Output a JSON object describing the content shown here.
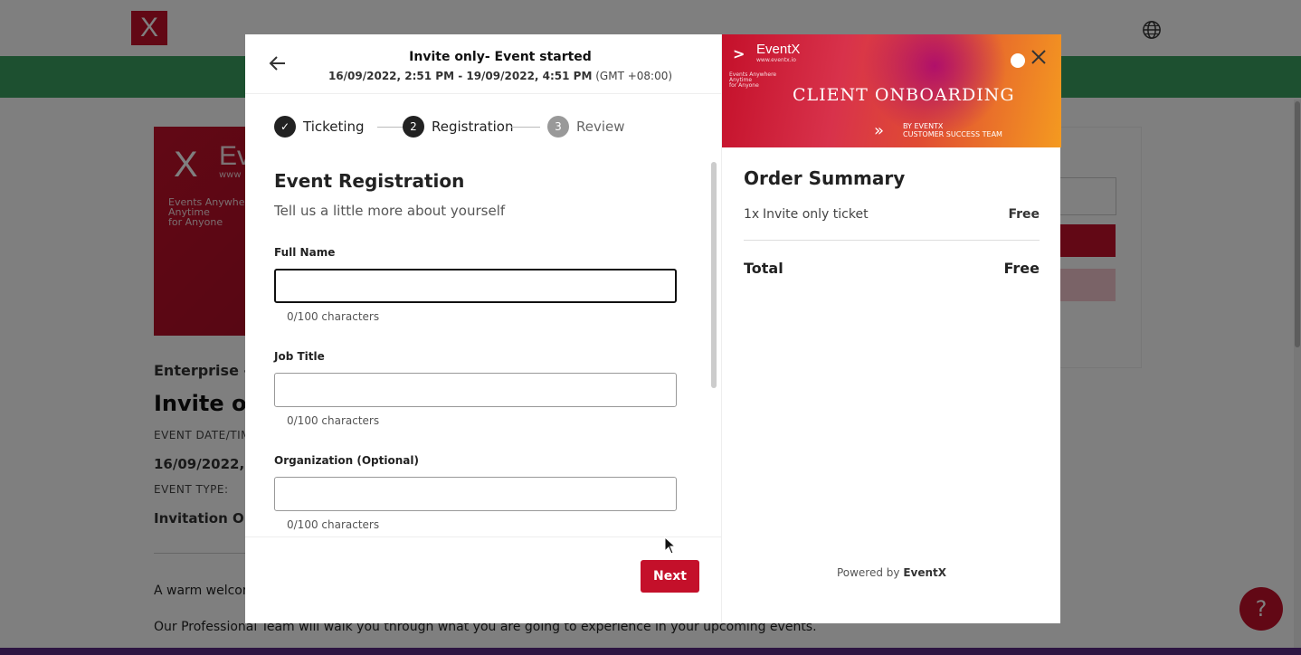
{
  "background": {
    "logo_glyph": "X",
    "banner": {
      "x": "X",
      "brand": "Ev",
      "www": "www",
      "tag_line1": "Events Anywhere",
      "tag_line2": "Anytime",
      "tag_line3": "for Anyone"
    },
    "subtitle": "Enterprise - I",
    "title": "Invite on",
    "date_label": "EVENT DATE/TIM",
    "date_value": "16/09/2022, 2",
    "type_label": "EVENT TYPE:",
    "type_value": "Invitation On",
    "para1": "A warm welcom",
    "para2": "Our Professional Team will walk you through what you are going to experience in your upcoming events.",
    "help_glyph": "?"
  },
  "modal": {
    "header": {
      "title": "Invite only- Event started",
      "date_range": "16/09/2022, 2:51 PM - 19/09/2022, 4:51 PM",
      "timezone": "(GMT +08:00)"
    },
    "steps": [
      {
        "number": "✓",
        "label": "Ticketing",
        "state": "done"
      },
      {
        "number": "2",
        "label": "Registration",
        "state": "active"
      },
      {
        "number": "3",
        "label": "Review",
        "state": "pending"
      }
    ],
    "form": {
      "title": "Event Registration",
      "subtitle": "Tell us a little more about yourself",
      "fields": [
        {
          "label": "Full Name",
          "value": "",
          "char_count": "0/100 characters"
        },
        {
          "label": "Job Title",
          "value": "",
          "char_count": "0/100 characters"
        },
        {
          "label": "Organization (Optional)",
          "value": "",
          "char_count": "0/100 characters"
        }
      ]
    },
    "next_label": "Next",
    "hero": {
      "x": "X",
      "brand": "EventX",
      "www": "www.eventx.io",
      "tag_line1": "Events Anywhere",
      "tag_line2": "Anytime",
      "tag_line3": "for Anyone",
      "title": "CLIENT ONBOARDING",
      "arrows": "»",
      "by_line1": "BY EVENTX",
      "by_line2": "CUSTOMER SUCCESS TEAM"
    },
    "summary": {
      "title": "Order Summary",
      "item_qty": "1x",
      "item_name": "Invite only ticket",
      "item_price": "Free",
      "total_label": "Total",
      "total_value": "Free"
    },
    "powered_prefix": "Powered by",
    "powered_brand": "EventX"
  },
  "colors": {
    "brand_red": "#c4102a",
    "green_bar": "#3aa060"
  }
}
